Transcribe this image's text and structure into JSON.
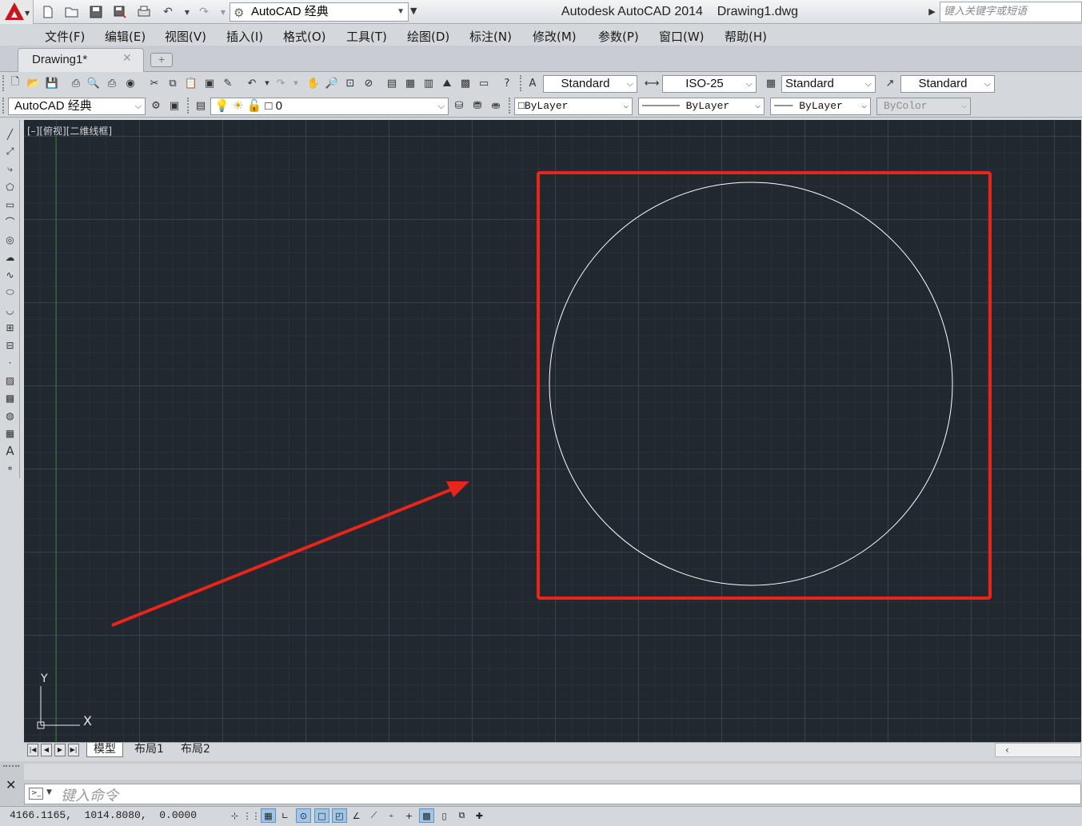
{
  "titlebar": {
    "workspace": "AutoCAD 经典",
    "title": "Autodesk AutoCAD 2014    Drawing1.dwg",
    "search_placeholder": "键入关键字或短语",
    "icons": [
      "new-icon",
      "open-icon",
      "save-icon",
      "save-as-icon",
      "plot-icon",
      "undo-icon",
      "redo-icon"
    ]
  },
  "menu": [
    "文件(F)",
    "编辑(E)",
    "视图(V)",
    "插入(I)",
    "格式(O)",
    "工具(T)",
    "绘图(D)",
    "标注(N)",
    "修改(M)",
    "参数(P)",
    "窗口(W)",
    "帮助(H)"
  ],
  "doc_tab": {
    "label": "Drawing1*",
    "close": "✕"
  },
  "styles_toolbar": {
    "text_style": "Standard",
    "dim_style": "ISO-25",
    "table_style": "Standard",
    "multileader_style": "Standard"
  },
  "layers_toolbar": {
    "workspace": "AutoCAD 经典",
    "layer": "0",
    "color": "ByLayer",
    "linetype": "ByLayer",
    "lineweight": "ByLayer",
    "plotstyle": "ByColor"
  },
  "viewport_label": "[–][俯视][二维线框]",
  "ucs": {
    "x_label": "X",
    "y_label": "Y"
  },
  "drawing": {
    "circle_color": "#ffffff",
    "annotation_color": "#e8241b",
    "background": "#212830"
  },
  "layout_tabs": [
    "模型",
    "布局1",
    "布局2"
  ],
  "command_line": {
    "placeholder": "键入命令",
    "close": "✕"
  },
  "status": {
    "coordinates": "4166.1165,  1014.8080,  0.0000"
  }
}
